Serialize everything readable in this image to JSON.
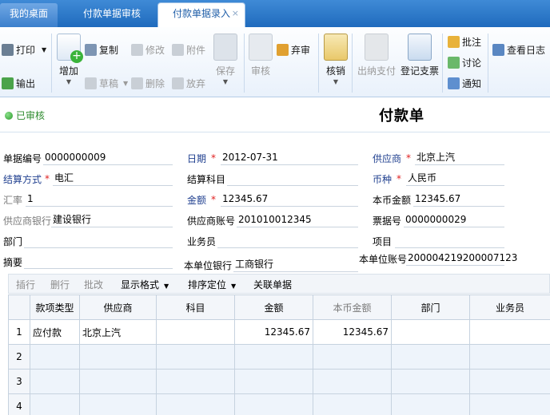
{
  "tabs": [
    {
      "label": "我的桌面"
    },
    {
      "label": "付款单据审核"
    },
    {
      "label": "付款单据录入",
      "close": "×"
    }
  ],
  "toolbar": {
    "print": "打印",
    "export": "输出",
    "add": "增加",
    "copy": "复制",
    "draft": "草稿",
    "edit": "修改",
    "delete": "删除",
    "attach": "附件",
    "discard": "放弃",
    "save": "保存",
    "audit": "审核",
    "abandon": "弃审",
    "writeoff": "核销",
    "outpay": "出纳支付",
    "register_bill": "登记支票",
    "annotate": "批注",
    "discuss": "讨论",
    "notify": "通知",
    "view_log": "查看日志"
  },
  "status": "已审核",
  "doc_title": "付款单",
  "form": {
    "doc_no_label": "单据编号",
    "doc_no": "0000000009",
    "date_label": "日期",
    "date": "2012-07-31",
    "supplier_label": "供应商",
    "supplier": "北京上汽",
    "settle_method_label": "结算方式",
    "settle_method": "电汇",
    "settle_subject_label": "结算科目",
    "settle_subject": "",
    "currency_label": "币种",
    "currency": "人民币",
    "rate_label": "汇率",
    "rate": "1",
    "amount_label": "金额",
    "amount": "12345.67",
    "local_amount_label": "本币金额",
    "local_amount": "12345.67",
    "supplier_bank_label": "供应商银行",
    "supplier_bank": "建设银行",
    "supplier_account_label": "供应商账号",
    "supplier_account": "201010012345",
    "bill_no_label": "票据号",
    "bill_no": "0000000029",
    "dept_label": "部门",
    "dept": "",
    "staff_label": "业务员",
    "staff": "",
    "project_label": "项目",
    "project": "",
    "memo_label": "摘要",
    "memo": "",
    "our_bank_label": "本单位银行",
    "our_bank": "工商银行",
    "our_account_label": "本单位账号",
    "our_account": "200004219200007123"
  },
  "gridbar": {
    "insert": "插行",
    "delete_row": "删行",
    "batch_edit": "批改",
    "display_format": "显示格式",
    "sort": "排序定位",
    "link_doc": "关联单据"
  },
  "grid": {
    "columns": [
      "款项类型",
      "供应商",
      "科目",
      "金额",
      "本币金额",
      "部门",
      "业务员"
    ],
    "rows": [
      {
        "no": "1",
        "type": "应付款",
        "supplier": "北京上汽",
        "subject": "",
        "amount": "12345.67",
        "local_amount": "12345.67",
        "dept": "",
        "staff": ""
      },
      {
        "no": "2"
      },
      {
        "no": "3"
      },
      {
        "no": "4"
      }
    ]
  }
}
